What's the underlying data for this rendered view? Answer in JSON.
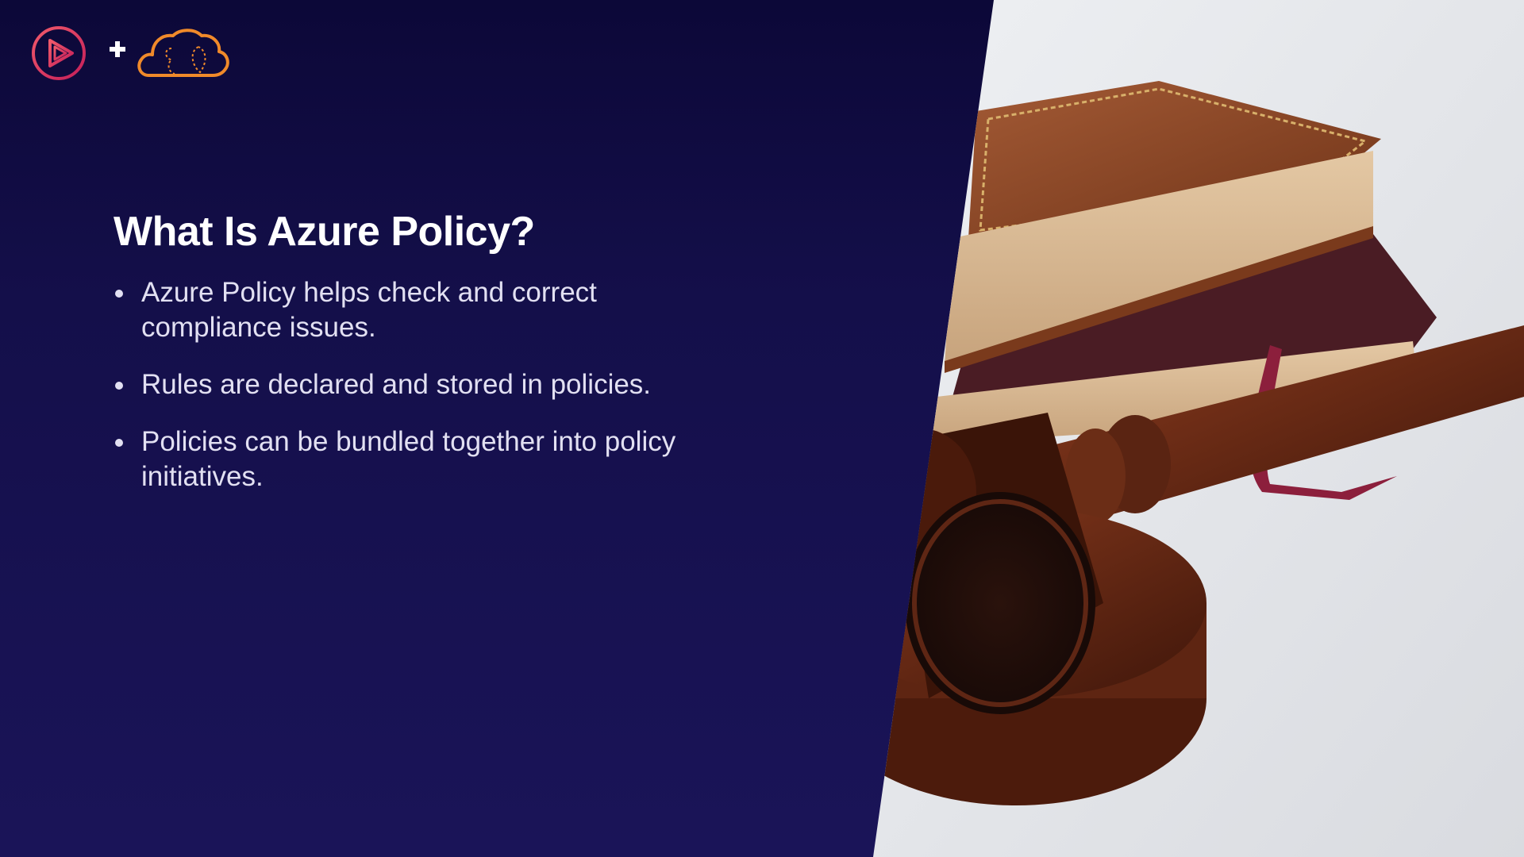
{
  "slide": {
    "title": "What Is Azure Policy?",
    "bullets": [
      "Azure Policy helps check and correct compliance issues.",
      "Rules are declared and stored in policies.",
      "Policies can be bundled together into policy initiatives."
    ]
  },
  "logos": {
    "left_logo": "play-logo-icon",
    "separator": "plus-icon",
    "right_logo": "cloud-logo-icon"
  },
  "image": {
    "subject": "gavel-and-books-photo"
  },
  "colors": {
    "background_top": "#0c0838",
    "background_bottom": "#1a1458",
    "title": "#ffffff",
    "body_text": "#e2e0f2",
    "logo_pink": "#e8386f",
    "logo_orange": "#f08a2a"
  }
}
